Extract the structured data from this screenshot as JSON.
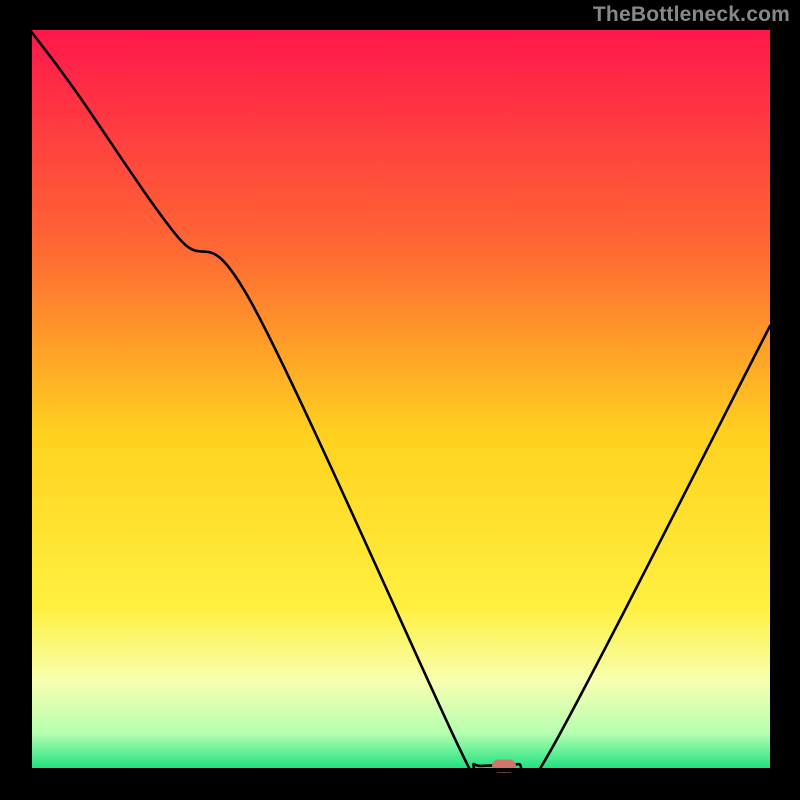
{
  "watermark": "TheBottleneck.com",
  "chart_data": {
    "type": "line",
    "title": "",
    "xlabel": "",
    "ylabel": "",
    "xlim": [
      0,
      100
    ],
    "ylim": [
      0,
      100
    ],
    "grid": false,
    "legend": false,
    "gradient_stops": [
      {
        "pos": 0.0,
        "color": "#ff174b"
      },
      {
        "pos": 0.3,
        "color": "#ff6a33"
      },
      {
        "pos": 0.55,
        "color": "#ffd21f"
      },
      {
        "pos": 0.78,
        "color": "#fff040"
      },
      {
        "pos": 0.88,
        "color": "#f7ffb0"
      },
      {
        "pos": 0.95,
        "color": "#b6ffb0"
      },
      {
        "pos": 1.0,
        "color": "#19e07f"
      }
    ],
    "series": [
      {
        "name": "bottleneck-curve",
        "x": [
          0,
          6,
          20,
          30,
          58,
          60,
          62,
          66,
          70,
          100
        ],
        "values": [
          100,
          92,
          72,
          63,
          3,
          0.8,
          0.6,
          0.8,
          2,
          60
        ]
      }
    ],
    "marker": {
      "x": 64,
      "y": 0.6,
      "color": "#cf756e"
    },
    "axis_color": "#000000"
  }
}
